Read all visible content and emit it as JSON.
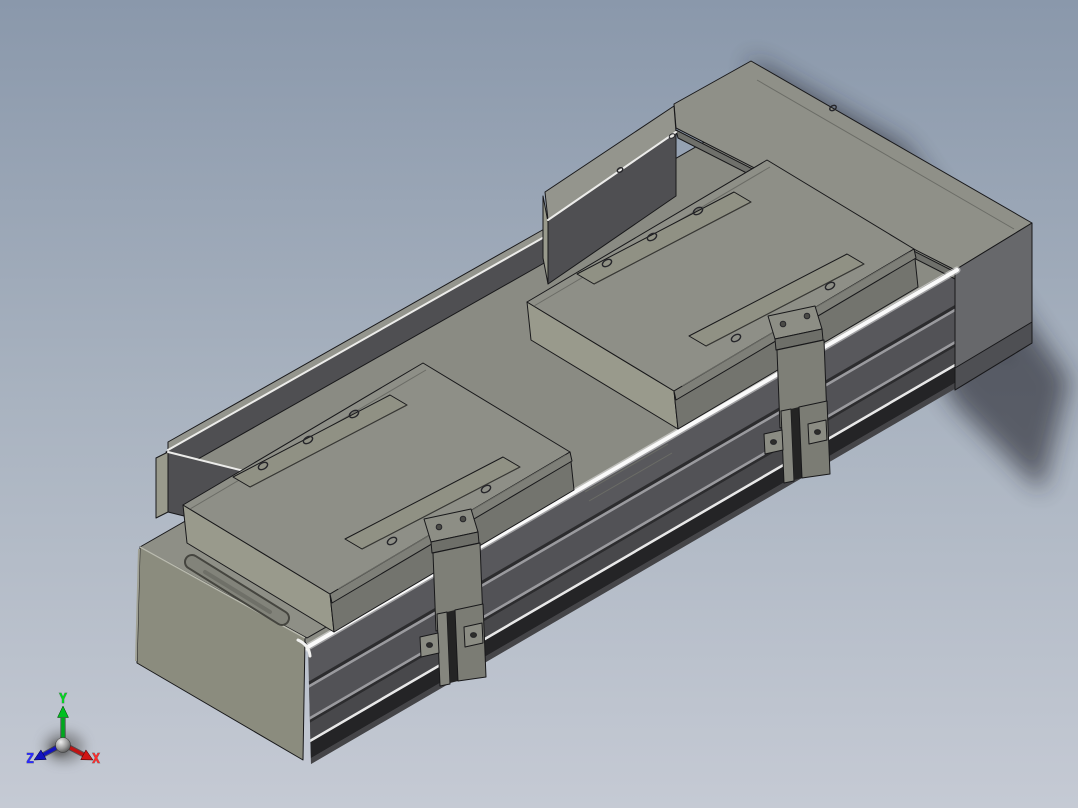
{
  "triad": {
    "axes": [
      {
        "id": "x",
        "label": "X",
        "color": "#ff2a2a"
      },
      {
        "id": "y",
        "label": "Y",
        "color": "#00d91e"
      },
      {
        "id": "z",
        "label": "Z",
        "color": "#2a2aff"
      }
    ]
  },
  "colors": {
    "bg_top": "#8a98ab",
    "bg_mid": "#a9b3c0",
    "bg_bottom": "#c5cad4",
    "face_top": "#8e8f87",
    "face_light": "#999a8c",
    "face_front": "#73746e",
    "face_bevel": "#7e7f78",
    "plate": "#909184",
    "rail_top": "#8a8b83",
    "endcap": "#8b8c7e",
    "endcap_top": "#8e8f86",
    "motor_top": "#8f9088",
    "motor_front": "#67686b",
    "motor_front_dark": "#4e4f53",
    "backwall": "#4f4f52",
    "backwall_top": "#94958d",
    "bracket_face": "#7e7f77",
    "bracket_top": "#8d8e85",
    "nub": "#8b8c83",
    "side_base": "#58585c",
    "side_groove": "#2c2c2e",
    "side_lightline": "#9a9a9e",
    "side_mid": "#525256",
    "side_band": "#48484b",
    "side_deep": "#242426",
    "side_bottom": "#454548",
    "side_white": "#e8e8e8",
    "highlight": "#fafafa",
    "edge": "#18181a",
    "axis_x": "#ff2a2a",
    "axis_y": "#00d91e",
    "axis_z": "#2a2aff",
    "shadow": "#232830"
  }
}
